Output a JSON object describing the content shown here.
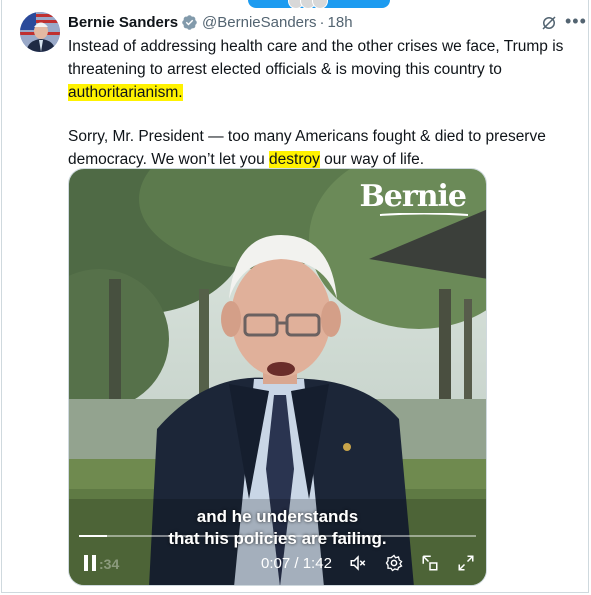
{
  "tweet": {
    "author_name": "Bernie Sanders",
    "handle": "@BernieSanders",
    "separator": "·",
    "time": "18h",
    "paragraph1_pre": "Instead of addressing health care and the other crises we face, Trump is threatening to arrest elected officials & is moving this country to ",
    "paragraph1_highlight": "authoritarianism.",
    "paragraph2_pre": "Sorry, Mr. President — too many Americans fought & died to preserve democracy. We won’t let you ",
    "paragraph2_highlight": "destroy",
    "paragraph2_post": " our way of life."
  },
  "icons": {
    "verified": "verified-badge-icon",
    "grok": "grok-icon",
    "more": "more-icon",
    "pause": "pause-icon",
    "mute": "mute-icon",
    "settings": "gear-icon",
    "pip": "picture-in-picture-icon",
    "fullscreen": "fullscreen-icon"
  },
  "video": {
    "brand_text": "Bernie",
    "caption_line1": "and he understands",
    "caption_line2": "that his policies are failing.",
    "ghost_time": ":34",
    "current_time": "0:07",
    "duration": "1:42",
    "time_separator": " / ",
    "progress_fraction": 0.07,
    "muted": true
  },
  "colors": {
    "accent": "#1d9bf0",
    "highlight": "#fff200",
    "secondary_text": "#536471",
    "border": "#cfd9de"
  }
}
